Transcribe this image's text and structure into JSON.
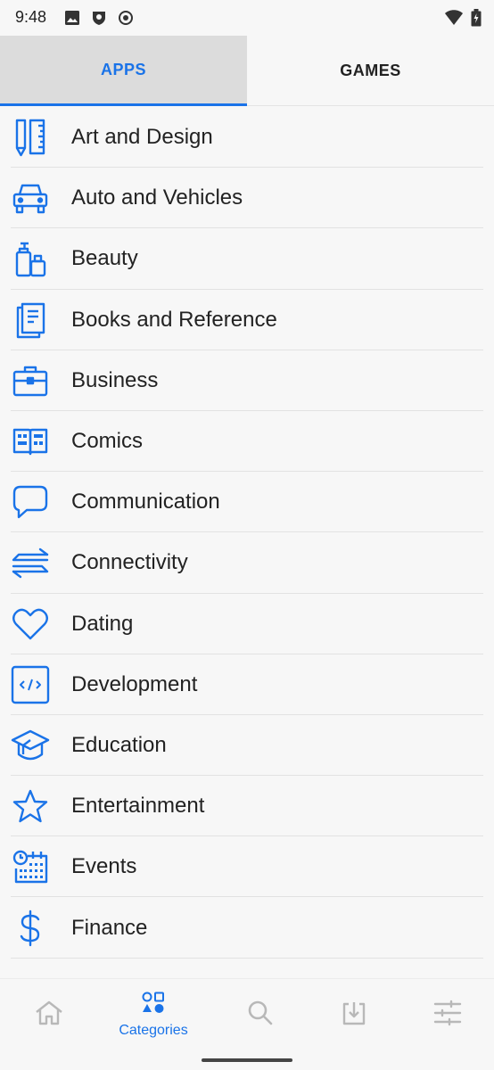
{
  "status_bar": {
    "time": "9:48",
    "left_icons": [
      "image-icon",
      "shield-icon",
      "record-icon"
    ],
    "right_icons": [
      "wifi-icon",
      "battery-icon"
    ]
  },
  "tabs": [
    {
      "label": "APPS",
      "active": true
    },
    {
      "label": "GAMES",
      "active": false
    }
  ],
  "categories": [
    {
      "label": "Art and Design",
      "icon": "ruler-pencil-icon"
    },
    {
      "label": "Auto and Vehicles",
      "icon": "car-icon"
    },
    {
      "label": "Beauty",
      "icon": "cosmetics-icon"
    },
    {
      "label": "Books and Reference",
      "icon": "book-icon"
    },
    {
      "label": "Business",
      "icon": "briefcase-icon"
    },
    {
      "label": "Comics",
      "icon": "comic-icon"
    },
    {
      "label": "Communication",
      "icon": "chat-bubble-icon"
    },
    {
      "label": "Connectivity",
      "icon": "arrows-exchange-icon"
    },
    {
      "label": "Dating",
      "icon": "heart-icon"
    },
    {
      "label": "Development",
      "icon": "code-icon"
    },
    {
      "label": "Education",
      "icon": "graduation-cap-icon"
    },
    {
      "label": "Entertainment",
      "icon": "star-icon"
    },
    {
      "label": "Events",
      "icon": "calendar-clock-icon"
    },
    {
      "label": "Finance",
      "icon": "dollar-icon"
    }
  ],
  "bottom_nav": {
    "items": [
      {
        "name": "home",
        "icon": "home-icon",
        "label": ""
      },
      {
        "name": "categories",
        "icon": "categories-icon",
        "label": "Categories",
        "active": true
      },
      {
        "name": "search",
        "icon": "search-icon",
        "label": ""
      },
      {
        "name": "downloads",
        "icon": "download-icon",
        "label": ""
      },
      {
        "name": "settings",
        "icon": "sliders-icon",
        "label": ""
      }
    ]
  },
  "colors": {
    "accent": "#1a73e8",
    "inactive_icon": "#b8b8b8"
  }
}
